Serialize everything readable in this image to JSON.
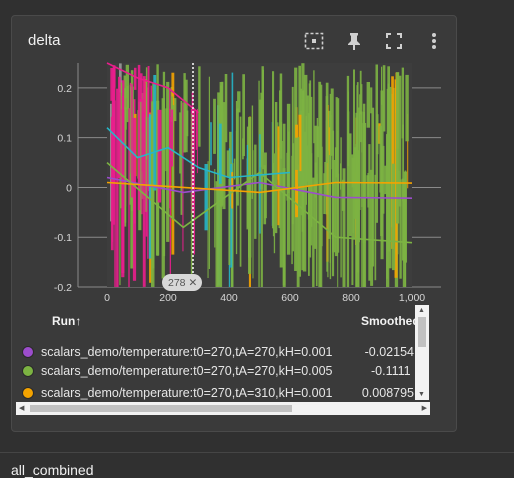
{
  "card": {
    "title": "delta",
    "tools": [
      "fit-domain-icon",
      "pin-icon",
      "fullscreen-icon",
      "more-vert-icon"
    ]
  },
  "chart_data": {
    "type": "line",
    "x_ticks": [
      "0",
      "200",
      "400",
      "600",
      "800",
      "1,000"
    ],
    "y_ticks": [
      "0.2",
      "0.1",
      "0",
      "-0.1",
      "-0.2"
    ],
    "xlim": [
      0,
      1000
    ],
    "ylim": [
      -0.2,
      0.2
    ],
    "hover_step": "278",
    "series": [
      {
        "color": "#9c4dcc",
        "x": [
          0,
          250,
          500,
          750,
          1000
        ],
        "values": [
          0.02,
          -0.01,
          0.01,
          -0.02,
          -0.02154
        ]
      },
      {
        "color": "#7cb342",
        "x": [
          0,
          250,
          500,
          750,
          1000
        ],
        "values": [
          0.05,
          -0.08,
          0.03,
          -0.1,
          -0.1111
        ]
      },
      {
        "color": "#f4a300",
        "x": [
          0,
          250,
          500,
          750,
          1000
        ],
        "values": [
          0.01,
          0.0,
          -0.01,
          0.01,
          0.008795
        ]
      },
      {
        "color": "#e91e8c",
        "x": [
          0,
          100,
          200,
          300
        ],
        "values": [
          0.25,
          0.22,
          0.2,
          0.15
        ]
      },
      {
        "color": "#26b6c8",
        "x": [
          0,
          100,
          200,
          300,
          400,
          600
        ],
        "values": [
          0.12,
          0.06,
          0.08,
          0.04,
          0.02,
          0.03
        ]
      }
    ]
  },
  "table": {
    "col_run": "Run",
    "col_run_sort": "↑",
    "col_smoothed": "Smoothed",
    "rows": [
      {
        "color": "#9c4dcc",
        "name": "scalars_demo/temperature:t0=270,tA=270,kH=0.001",
        "smoothed": "-0.02154"
      },
      {
        "color": "#7cb342",
        "name": "scalars_demo/temperature:t0=270,tA=270,kH=0.005",
        "smoothed": "-0.1111"
      },
      {
        "color": "#f4a300",
        "name": "scalars_demo/temperature:t0=270,tA=310,kH=0.001",
        "smoothed": "0.008795"
      }
    ]
  },
  "next_card": {
    "title": "all_combined"
  }
}
